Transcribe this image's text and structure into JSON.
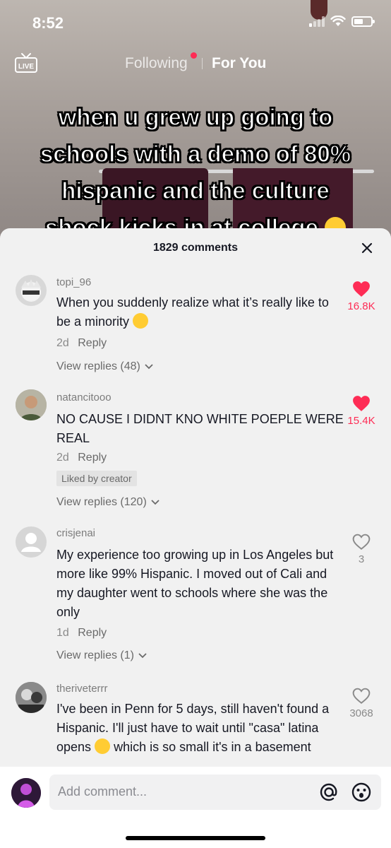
{
  "status_bar": {
    "time": "8:52"
  },
  "nav": {
    "live_label": "LIVE",
    "following": "Following",
    "for_you": "For You"
  },
  "caption": {
    "line1": "when u grew up going to",
    "line2": "schools with a demo of 80%",
    "line3": "hispanic and the culture",
    "line4": "shock kicks in at college"
  },
  "sheet": {
    "comment_count": "1829 comments"
  },
  "comments": [
    {
      "username": "topi_96",
      "text": "When you suddenly realize what it’s really like to be a minority",
      "age": "2d",
      "reply": "Reply",
      "view_replies": "View replies (48)",
      "likes": "16.8K",
      "liked": true
    },
    {
      "username": "natancitooo",
      "text": "NO CAUSE I DIDNT KNO WHITE POEPLE WERE REAL",
      "age": "2d",
      "reply": "Reply",
      "badge": "Liked by creator",
      "view_replies": "View replies (120)",
      "likes": "15.4K",
      "liked": true
    },
    {
      "username": "crisjenai",
      "text": "My experience too growing up in Los Angeles but more like 99% Hispanic. I moved out of Cali and my daughter went to schools where she was the only",
      "age": "1d",
      "reply": "Reply",
      "view_replies": "View replies (1)",
      "likes": "3",
      "liked": false
    },
    {
      "username": "theriveterrr",
      "text1": "I've been in Penn for 5 days, still haven't found a Hispanic. I'll just have to wait until \"casa\" latina opens",
      "text2": "which is so small it's in a basement",
      "likes": "3068",
      "liked": false
    }
  ],
  "composer": {
    "placeholder": "Add comment..."
  },
  "colors": {
    "accent": "#fe2c55",
    "sheet_bg": "#f1f1f1",
    "text": "#161823"
  }
}
